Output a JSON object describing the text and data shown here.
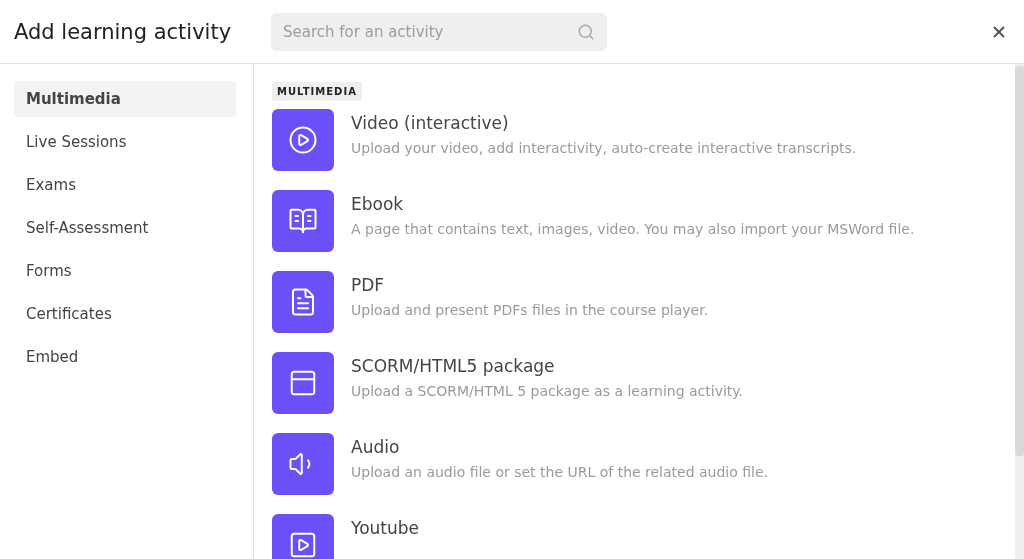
{
  "window": {
    "title": "Add learning activity"
  },
  "search": {
    "placeholder": "Search for an activity"
  },
  "sidebar": {
    "items": [
      {
        "label": "Multimedia",
        "selected": true
      },
      {
        "label": "Live Sessions",
        "selected": false
      },
      {
        "label": "Exams",
        "selected": false
      },
      {
        "label": "Self-Assessment",
        "selected": false
      },
      {
        "label": "Forms",
        "selected": false
      },
      {
        "label": "Certificates",
        "selected": false
      },
      {
        "label": "Embed",
        "selected": false
      }
    ]
  },
  "section": {
    "label": "MULTIMEDIA",
    "activities": [
      {
        "kind": "video",
        "title": "Video (interactive)",
        "description": "Upload your video, add interactivity, auto-create interactive transcripts."
      },
      {
        "kind": "ebook",
        "title": "Ebook",
        "description": "A page that contains text, images, video. You may also import your MSWord file."
      },
      {
        "kind": "pdf",
        "title": "PDF",
        "description": "Upload and present PDFs files in the course player."
      },
      {
        "kind": "scorm",
        "title": "SCORM/HTML5 package",
        "description": "Upload a SCORM/HTML 5 package as a learning activity."
      },
      {
        "kind": "audio",
        "title": "Audio",
        "description": "Upload an audio file or set the URL of the related audio file."
      },
      {
        "kind": "youtube",
        "title": "Youtube"
      }
    ]
  }
}
